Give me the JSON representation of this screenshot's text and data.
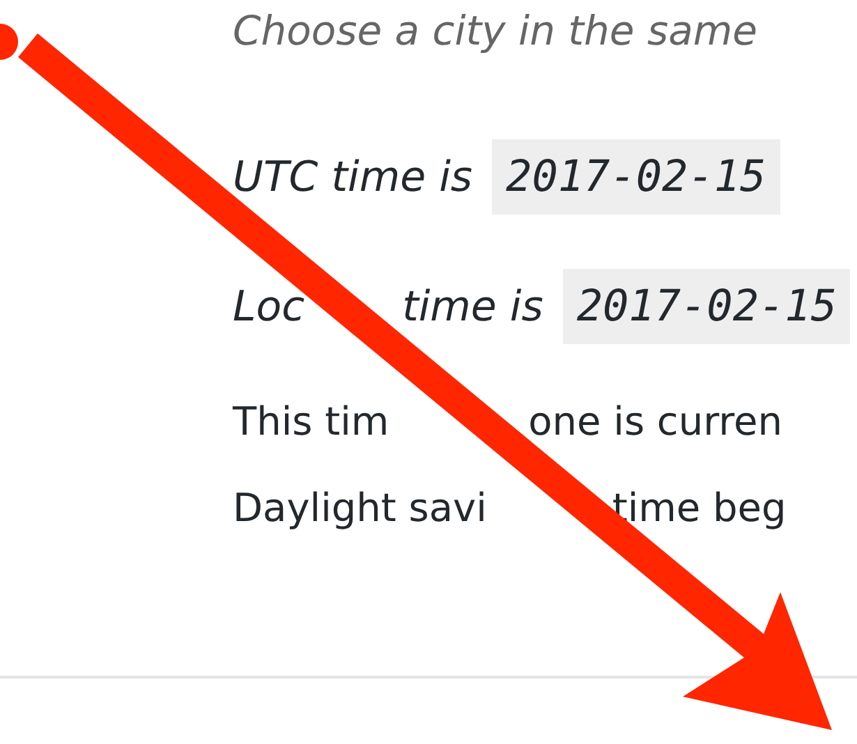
{
  "description": "Choose a city in the same",
  "times": [
    {
      "label": [
        "UTC time is"
      ],
      "value": "2017-02-15"
    },
    {
      "label": [
        "Loc",
        "time is"
      ],
      "value": "2017-02-15"
    }
  ],
  "info_lines": [
    [
      "This tim",
      "one is curren"
    ],
    [
      "Daylight savi",
      "time beg"
    ]
  ],
  "annotation": {
    "kind": "arrow"
  }
}
